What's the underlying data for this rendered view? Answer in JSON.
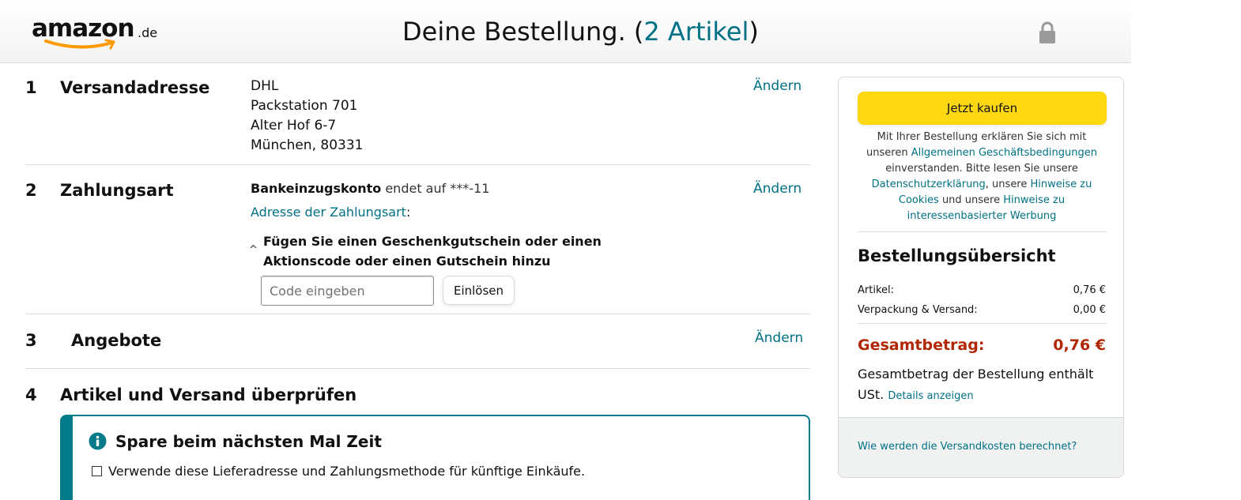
{
  "header": {
    "logo_word": "amazon",
    "logo_tld": ".de",
    "title_prefix": "Deine Bestellung. (",
    "title_count": "2 Artikel",
    "title_suffix": ")",
    "lock_icon": "lock-icon"
  },
  "shipping": {
    "number": "1",
    "title": "Versandadresse",
    "address_lines": [
      "DHL",
      "Packstation 701",
      "Alter Hof 6-7",
      "München, 80331"
    ],
    "change_label": "Ändern"
  },
  "payment": {
    "number": "2",
    "title": "Zahlungsart",
    "method": "Bankeinzugskonto",
    "ending_text": "endet auf",
    "account_suffix": "***-11",
    "billing_address_label": "Adresse der Zahlungsart",
    "billing_address_colon": ":",
    "change_label": "Ändern",
    "voucher_caret": "^",
    "voucher_text": "Fügen Sie einen Geschenkgutschein oder einen Aktionscode oder einen Gutschein hinzu",
    "code_placeholder": "Code eingeben",
    "redeem_label": "Einlösen"
  },
  "offers": {
    "number": "3",
    "title": "Angebote",
    "change_label": "Ändern"
  },
  "review": {
    "number": "4",
    "title": "Artikel und Versand überprüfen",
    "info_title": "Spare beim nächsten Mal Zeit",
    "info_checkbox_label": "Verwende diese Lieferadresse und Zahlungsmethode für künftige Einkäufe."
  },
  "sidebar": {
    "buy_label": "Jetzt kaufen",
    "legal": {
      "part1": "Mit Ihrer Bestellung erklären Sie sich mit unseren ",
      "link_agb": "Allgemeinen Geschäftsbedingungen",
      "part2": " einverstanden. Bitte lesen Sie unsere ",
      "link_privacy": "Datenschutzerklärung",
      "part3": ", unsere ",
      "link_cookies": "Hinweise zu Cookies",
      "part4": " und unsere ",
      "link_ads": "Hinweise zu interessenbasierter Werbung"
    },
    "summary_title": "Bestellungsübersicht",
    "rows": [
      {
        "label": "Artikel:",
        "value": "0,76 €"
      },
      {
        "label": "Verpackung & Versand:",
        "value": "0,00 €"
      }
    ],
    "total_label": "Gesamtbetrag:",
    "total_value": "0,76 €",
    "vat_text": "Gesamtbetrag der Bestellung enthält USt.",
    "details_link": "Details anzeigen",
    "shipping_cost_link": "Wie werden die Versandkosten berechnet?"
  },
  "colors": {
    "link": "#007185",
    "price": "#B12704",
    "buy_button": "#FFD814",
    "info_accent": "#037B8B"
  }
}
